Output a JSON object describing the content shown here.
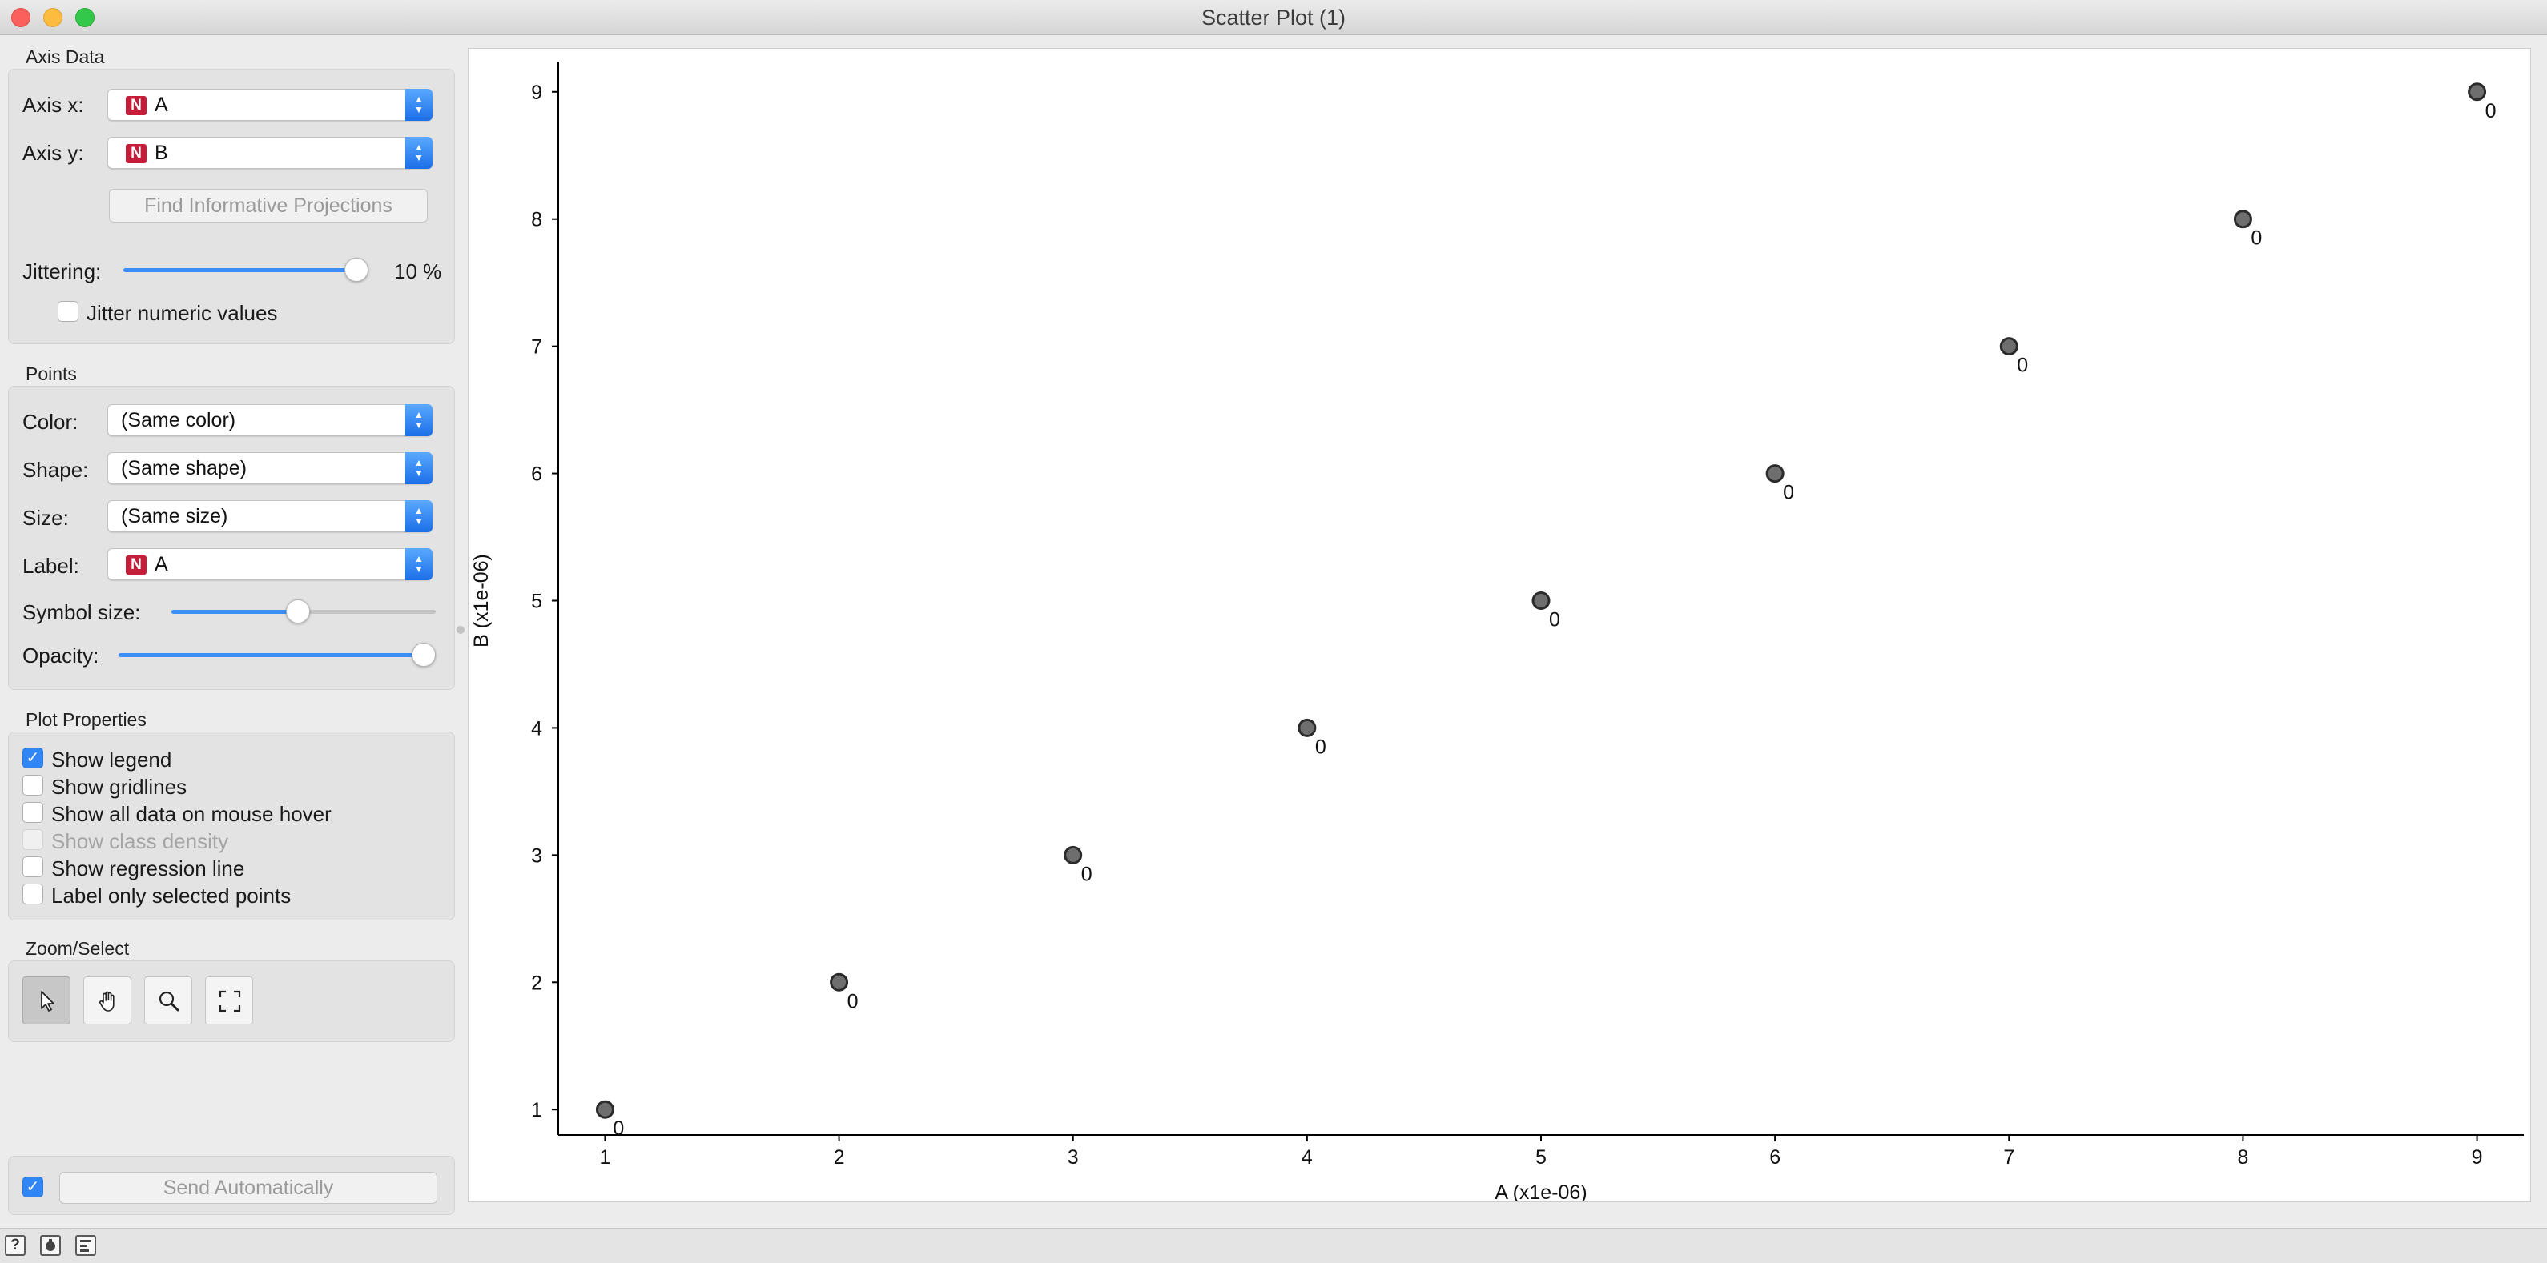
{
  "window": {
    "title": "Scatter Plot (1)"
  },
  "axis_data": {
    "title": "Axis Data",
    "axis_x": {
      "label": "Axis x:",
      "value": "A",
      "type_badge": "N"
    },
    "axis_y": {
      "label": "Axis y:",
      "value": "B",
      "type_badge": "N"
    },
    "find_button": "Find Informative Projections",
    "jittering": {
      "label": "Jittering:",
      "value_text": "10 %",
      "fraction": 1.0
    },
    "jitter_numeric": {
      "label": "Jitter numeric values",
      "checked": false
    }
  },
  "points": {
    "title": "Points",
    "color": {
      "label": "Color:",
      "value": "(Same color)"
    },
    "shape": {
      "label": "Shape:",
      "value": "(Same shape)"
    },
    "size": {
      "label": "Size:",
      "value": "(Same size)"
    },
    "label": {
      "label": "Label:",
      "value": "A",
      "type_badge": "N"
    },
    "symbol_size": {
      "label": "Symbol size:",
      "fraction": 0.48
    },
    "opacity": {
      "label": "Opacity:",
      "fraction": 1.0
    }
  },
  "plot_properties": {
    "title": "Plot Properties",
    "options": [
      {
        "label": "Show legend",
        "checked": true,
        "enabled": true
      },
      {
        "label": "Show gridlines",
        "checked": false,
        "enabled": true
      },
      {
        "label": "Show all data on mouse hover",
        "checked": false,
        "enabled": true
      },
      {
        "label": "Show class density",
        "checked": false,
        "enabled": false
      },
      {
        "label": "Show regression line",
        "checked": false,
        "enabled": true
      },
      {
        "label": "Label only selected points",
        "checked": false,
        "enabled": true
      }
    ]
  },
  "zoom_select": {
    "title": "Zoom/Select",
    "tools": [
      {
        "name": "select-icon",
        "active": true
      },
      {
        "name": "pan-hand-icon",
        "active": false
      },
      {
        "name": "zoom-icon",
        "active": false
      },
      {
        "name": "reset-zoom-icon",
        "active": false
      }
    ]
  },
  "send": {
    "label": "Send Automatically",
    "checked": true
  },
  "statusbar": {
    "icons": [
      "help-icon",
      "report-icon",
      "output-icon"
    ],
    "help_glyph": "?"
  },
  "chart_data": {
    "type": "scatter",
    "xlabel": "A (x1e-06)",
    "ylabel": "B (x1e-06)",
    "xlim": [
      0.8,
      9.2
    ],
    "ylim": [
      0.8,
      9.2
    ],
    "xticks": [
      "1",
      "2",
      "3",
      "4",
      "5",
      "6",
      "7",
      "8",
      "9"
    ],
    "yticks": [
      "1",
      "2",
      "3",
      "4",
      "5",
      "6",
      "7",
      "8",
      "9"
    ],
    "grid": false,
    "point_color": "#6e6e6e",
    "series": [
      {
        "x": [
          1,
          2,
          3,
          4,
          5,
          6,
          7,
          8,
          9
        ],
        "y": [
          1,
          2,
          3,
          4,
          5,
          6,
          7,
          8,
          9
        ],
        "labels": [
          "0",
          "0",
          "0",
          "0",
          "0",
          "0",
          "0",
          "0",
          "0"
        ]
      }
    ]
  }
}
